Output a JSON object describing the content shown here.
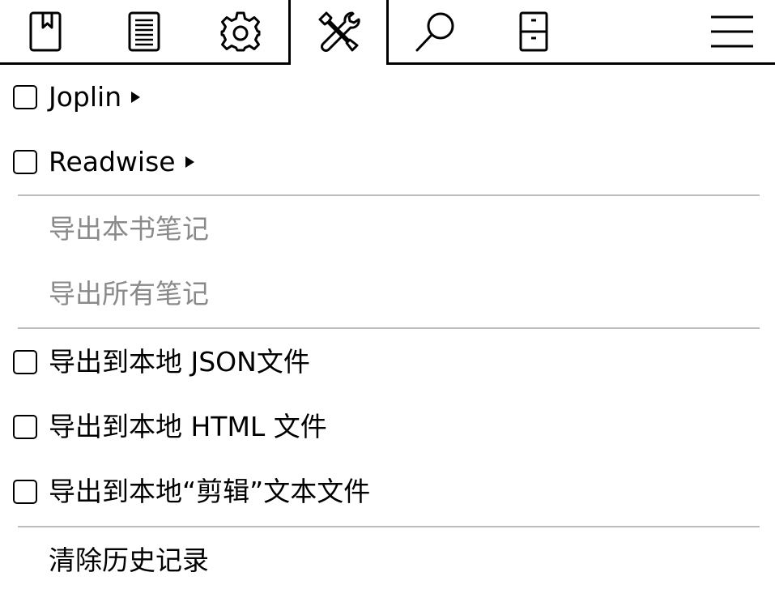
{
  "tabs": [
    {
      "id": "bookmarks",
      "icon": "bookmark-icon",
      "selected": false
    },
    {
      "id": "toc",
      "icon": "list-icon",
      "selected": false
    },
    {
      "id": "settings",
      "icon": "gear-icon",
      "selected": false
    },
    {
      "id": "tools",
      "icon": "tools-icon",
      "selected": true
    },
    {
      "id": "search",
      "icon": "search-icon",
      "selected": false
    },
    {
      "id": "library",
      "icon": "cabinet-icon",
      "selected": false
    },
    {
      "id": "menu",
      "icon": "hamburger-icon",
      "selected": false
    }
  ],
  "menu": {
    "joplin": {
      "label": "Joplin",
      "checked": false,
      "has_submenu": true
    },
    "readwise": {
      "label": "Readwise",
      "checked": false,
      "has_submenu": true
    },
    "export_book_notes": {
      "label": "导出本书笔记",
      "enabled": false
    },
    "export_all_notes": {
      "label": "导出所有笔记",
      "enabled": false
    },
    "export_json": {
      "label": "导出到本地 JSON文件",
      "checked": false
    },
    "export_html": {
      "label": "导出到本地 HTML 文件",
      "checked": false
    },
    "export_clippings": {
      "label": "导出到本地“剪辑”文本文件",
      "checked": false
    },
    "clear_history": {
      "label": "清除历史记录",
      "enabled": true
    }
  },
  "colors": {
    "foreground": "#000000",
    "background": "#ffffff",
    "disabled_text": "#8a8a8a",
    "separator": "#bdbdbd"
  }
}
